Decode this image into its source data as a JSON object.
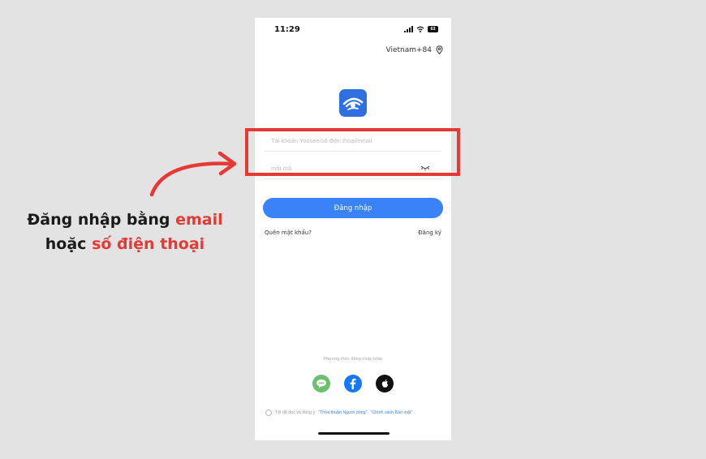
{
  "status_bar": {
    "time": "11:29",
    "battery": "63"
  },
  "header": {
    "region": "Vietnam+84"
  },
  "form": {
    "account_placeholder": "Tài khoản Yoosee/số điện thoại/email",
    "password_placeholder": "mật mã",
    "login_label": "Đăng nhập",
    "forgot_label": "Quên mật khẩu?",
    "register_label": "Đăng ký"
  },
  "other_login": {
    "title": "Phương thức đăng nhập khác",
    "providers": [
      "line-icon",
      "facebook-icon",
      "apple-icon"
    ]
  },
  "terms": {
    "prefix": "Tôi đã đọc và đồng ý",
    "user_agreement": "\"Thỏa thuận Người dùng\"",
    "privacy_policy": "\"Chính sách Bảo mật\""
  },
  "annotation": {
    "line1_prefix": "Đăng nhập bằng",
    "line1_highlight": "email",
    "line2_prefix": "hoặc",
    "line2_highlight": "số điện thoại"
  },
  "colors": {
    "accent": "#3a82f7",
    "highlight": "#e53935",
    "background": "#e4e3e4"
  }
}
